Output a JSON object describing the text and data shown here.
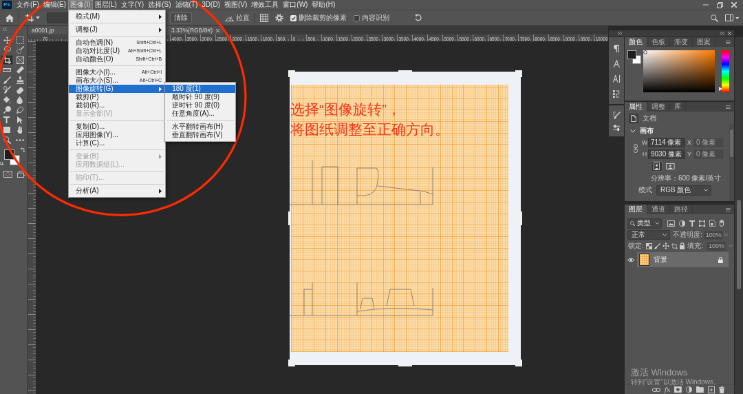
{
  "app_logo": "Ps",
  "menu_bar": {
    "items": [
      {
        "label": "文件(F)",
        "open": false
      },
      {
        "label": "编辑(E)",
        "open": false
      },
      {
        "label": "图像(I)",
        "open": true,
        "menu": [
          {
            "kind": "item",
            "label": "模式(M)",
            "submenu": true,
            "disabled": false,
            "highlighted": false
          },
          {
            "kind": "separator"
          },
          {
            "kind": "item",
            "label": "调整(J)",
            "submenu": true,
            "disabled": false,
            "highlighted": false
          },
          {
            "kind": "separator"
          },
          {
            "kind": "item",
            "label": "自动色调(N)",
            "shortcut": "Shift+Ctrl+L",
            "submenu": false,
            "disabled": false,
            "highlighted": false
          },
          {
            "kind": "item",
            "label": "自动对比度(U)",
            "shortcut": "Alt+Shift+Ctrl+L",
            "submenu": false,
            "disabled": false,
            "highlighted": false
          },
          {
            "kind": "item",
            "label": "自动颜色(O)",
            "shortcut": "Shift+Ctrl+B",
            "submenu": false,
            "disabled": false,
            "highlighted": false
          },
          {
            "kind": "separator"
          },
          {
            "kind": "item",
            "label": "图像大小(I)...",
            "shortcut": "Alt+Ctrl+I",
            "submenu": false,
            "disabled": false,
            "highlighted": false
          },
          {
            "kind": "item",
            "label": "画布大小(S)...",
            "shortcut": "Alt+Ctrl+C",
            "submenu": false,
            "disabled": false,
            "highlighted": false
          },
          {
            "kind": "item",
            "label": "图像旋转(G)",
            "submenu": true,
            "disabled": false,
            "highlighted": true,
            "flyout": [
              {
                "kind": "item",
                "label": "180 度(1)",
                "submenu": false,
                "disabled": false,
                "highlighted": true
              },
              {
                "kind": "item",
                "label": "顺时针 90 度(9)",
                "submenu": false,
                "disabled": false,
                "highlighted": false
              },
              {
                "kind": "item",
                "label": "逆时针 90 度(0)",
                "submenu": false,
                "disabled": false,
                "highlighted": false
              },
              {
                "kind": "item",
                "label": "任意角度(A)...",
                "submenu": false,
                "disabled": false,
                "highlighted": false
              },
              {
                "kind": "separator"
              },
              {
                "kind": "item",
                "label": "水平翻转画布(H)",
                "submenu": false,
                "disabled": false,
                "highlighted": false
              },
              {
                "kind": "item",
                "label": "垂直翻转画布(V)",
                "submenu": false,
                "disabled": false,
                "highlighted": false
              }
            ]
          },
          {
            "kind": "item",
            "label": "裁剪(P)",
            "submenu": false,
            "disabled": false,
            "highlighted": false
          },
          {
            "kind": "item",
            "label": "裁切(R)...",
            "submenu": false,
            "disabled": false,
            "highlighted": false
          },
          {
            "kind": "item",
            "label": "显示全部(V)",
            "submenu": false,
            "disabled": true,
            "highlighted": false
          },
          {
            "kind": "separator"
          },
          {
            "kind": "item",
            "label": "复制(D)...",
            "submenu": false,
            "disabled": false,
            "highlighted": false
          },
          {
            "kind": "item",
            "label": "应用图像(Y)...",
            "submenu": false,
            "disabled": false,
            "highlighted": false
          },
          {
            "kind": "item",
            "label": "计算(C)...",
            "submenu": false,
            "disabled": false,
            "highlighted": false
          },
          {
            "kind": "separator"
          },
          {
            "kind": "item",
            "label": "变量(B)",
            "submenu": true,
            "disabled": true,
            "highlighted": false
          },
          {
            "kind": "item",
            "label": "应用数据组(L)...",
            "submenu": false,
            "disabled": true,
            "highlighted": false
          },
          {
            "kind": "separator"
          },
          {
            "kind": "item",
            "label": "陷印(T)...",
            "submenu": false,
            "disabled": true,
            "highlighted": false
          },
          {
            "kind": "separator"
          },
          {
            "kind": "item",
            "label": "分析(A)",
            "submenu": true,
            "disabled": false,
            "highlighted": false
          }
        ]
      },
      {
        "label": "图层(L)",
        "open": false
      },
      {
        "label": "文字(Y)",
        "open": false
      },
      {
        "label": "选择(S)",
        "open": false
      },
      {
        "label": "滤镜(T)",
        "open": false
      },
      {
        "label": "3D(D)",
        "open": false
      },
      {
        "label": "视图(V)",
        "open": false
      },
      {
        "label": "增效工具",
        "open": false
      },
      {
        "label": "窗口(W)",
        "open": false
      },
      {
        "label": "帮助(H)",
        "open": false
      }
    ]
  },
  "options_bar": {
    "clear_button": "清除",
    "straighten_button": "拉直",
    "checkboxes": [
      {
        "label": "删除裁剪的像素",
        "checked": true
      },
      {
        "label": "内容识别",
        "checked": false
      }
    ]
  },
  "toolbar": {
    "tools": [
      {
        "kind": "move",
        "selected": false
      },
      {
        "kind": "marquee",
        "selected": false
      },
      {
        "kind": "lasso",
        "selected": false
      },
      {
        "kind": "quickselect",
        "selected": false
      },
      {
        "kind": "crop",
        "selected": true
      },
      {
        "kind": "frame",
        "selected": false
      },
      {
        "kind": "ruler",
        "selected": false
      },
      {
        "kind": "healing",
        "selected": false
      },
      {
        "kind": "brush",
        "selected": false
      },
      {
        "kind": "stamp",
        "selected": false
      },
      {
        "kind": "historybrush",
        "selected": false
      },
      {
        "kind": "eraser",
        "selected": false
      },
      {
        "kind": "bucket",
        "selected": false
      },
      {
        "kind": "blur",
        "selected": false
      },
      {
        "kind": "dodge",
        "selected": false
      },
      {
        "kind": "pen",
        "selected": false
      },
      {
        "kind": "type",
        "selected": false
      },
      {
        "kind": "pathselect",
        "selected": false
      },
      {
        "kind": "shape",
        "selected": false
      },
      {
        "kind": "hand",
        "selected": false
      },
      {
        "kind": "zoom",
        "selected": false
      },
      {
        "kind": "more",
        "selected": false
      }
    ]
  },
  "document_tab": {
    "name_start": "a0001.jp",
    "name_end": "3.33%(RGB/8#)"
  },
  "horizontal_ruler": {
    "partial_label": "70",
    "labels": [
      "4000",
      "3500",
      "3000",
      "2500",
      "2000",
      "1500",
      "1000",
      "500",
      "0",
      "500",
      "1000",
      "1500",
      "2000",
      "2500",
      "3000",
      "3500",
      "4000",
      "4500",
      "5000",
      "5500",
      "6000",
      "6500",
      "7000",
      "7500",
      "8000",
      "8500",
      "9000",
      "9500",
      "10000"
    ]
  },
  "canvas": {
    "annotation_lines": [
      "选择“图像旋转”，",
      "将图纸调整至正确方向。"
    ]
  },
  "color_panel": {
    "tabs": [
      {
        "label": "颜色",
        "selected": true
      },
      {
        "label": "色板",
        "selected": false
      },
      {
        "label": "渐变",
        "selected": false
      },
      {
        "label": "图案",
        "selected": false
      }
    ],
    "hue": {
      "level": 0.08
    }
  },
  "properties_panel": {
    "tabs": [
      {
        "label": "属性",
        "selected": true
      },
      {
        "label": "调整",
        "selected": false
      },
      {
        "label": "库",
        "selected": false
      }
    ],
    "heading": "文档",
    "section": {
      "title": "画布",
      "expanded": true
    },
    "fields": [
      {
        "label": "W",
        "value": "7114 像素",
        "disabled": false
      },
      {
        "label": "X",
        "value": "0 像素",
        "disabled": true
      },
      {
        "label": "H",
        "value": "9030 像素",
        "disabled": false
      },
      {
        "label": "Y",
        "value": "0 像素",
        "disabled": true
      }
    ],
    "orientation": [
      {
        "kind": "portrait",
        "selected": true
      },
      {
        "kind": "landscape",
        "selected": false
      }
    ],
    "resolution": "分辨率：600 像素/英寸",
    "mode": {
      "label": "模式",
      "value": "RGB 颜色"
    }
  },
  "layers_panel": {
    "tabs": [
      {
        "label": "图层",
        "selected": true
      },
      {
        "label": "通道",
        "selected": false
      },
      {
        "label": "路径",
        "selected": false
      }
    ],
    "filter": "类型",
    "blend_mode": "正常",
    "opacity": {
      "label": "不透明度:",
      "value": "100%",
      "disabled": true
    },
    "lock_label": "锁定:",
    "fill": {
      "label": "填充:",
      "value": "100%",
      "disabled": true
    },
    "layers": [
      {
        "name": "背景",
        "visible": true,
        "locked": true,
        "selected": true
      }
    ],
    "fx_button": "fx"
  },
  "windows_activation": {
    "title": "激活 Windows",
    "subtitle": "转到“设置”以激活 Windows。"
  }
}
